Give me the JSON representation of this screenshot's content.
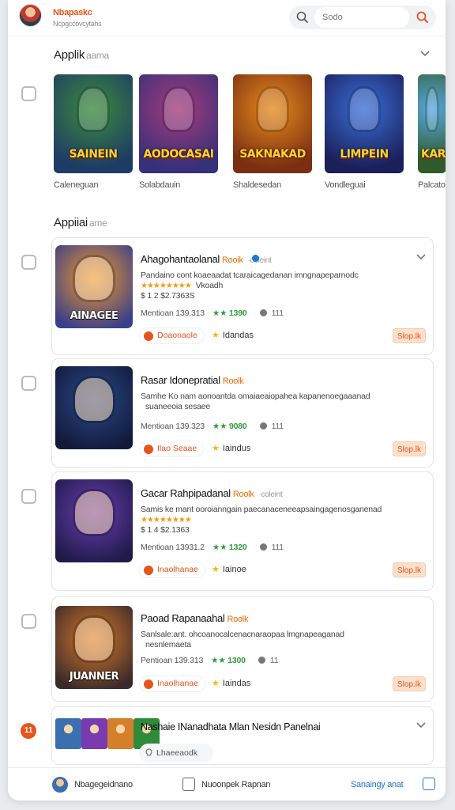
{
  "header": {
    "brand": "Nbapaskc",
    "brand_sub": "Ncpgccovcytahs",
    "search_placeholder": "Sodo"
  },
  "featured": {
    "title": "Applik",
    "title_muted": "aama",
    "items": [
      {
        "title": "SAINEIN",
        "label": "Caleneguan",
        "color1": "#3c8b3a",
        "color2": "#1d3b66"
      },
      {
        "title": "AODOCASAI",
        "label": "Solabdauin",
        "color1": "#a53b7a",
        "color2": "#37307a"
      },
      {
        "title": "SAKNAKAD",
        "label": "Shaldesedan",
        "color1": "#e68a1d",
        "color2": "#7a2f12"
      },
      {
        "title": "LIMPEIN",
        "label": "Vondleguai",
        "color1": "#3a6fd8",
        "color2": "#1b1f5a"
      },
      {
        "title": "KAR",
        "label": "Palcato",
        "color1": "#5aa8e0",
        "color2": "#2f5a2a"
      }
    ]
  },
  "apps_section": {
    "title": "Appiiai",
    "title_muted": "ame"
  },
  "apps": [
    {
      "thumb_title": "AINAGEE",
      "title": "Ahagohantaolanal",
      "tag": "Rooik",
      "mini": "·coleint",
      "desc_line1": "Pandaino cont koaeaadat tcaraicagedanan imngnapeparnodc",
      "stars": "★★★★★★★★",
      "desc_line2_suffix": "Vkoadh",
      "desc_line3": "$ 1 2 $2.7363S",
      "meta_prefix": "Mentioan 139.313",
      "rating": "★★ 1390",
      "downloads": "111",
      "pill": "Doaonaole",
      "fav": "Idandas",
      "install": "Slop.lk",
      "art1": "#f09a2a",
      "art2": "#3a3f8a"
    },
    {
      "thumb_title": "",
      "title": "Rasar Idonepratial",
      "tag": "Roolk",
      "mini": "",
      "desc_line1": "Samhe Ko nam aonoantda omaiaeaiopahea kapanenoegaaanad",
      "stars": "",
      "desc_line2_suffix": "suaneeoia sesaee",
      "desc_line3": "",
      "meta_prefix": "Mentioan 139.323",
      "rating": "★★ 9080",
      "downloads": "111",
      "pill": "Ilao Seaae",
      "fav": "Iaindus",
      "install": "Slop.lk",
      "art1": "#2a4a8a",
      "art2": "#12193a"
    },
    {
      "thumb_title": "",
      "title": "Gacar Rahpipadanal",
      "tag": "Roolk",
      "mini": "·coleint",
      "desc_line1": "Samis ke mant ooroianngain paecanaceneeapsaingagenosganenad",
      "stars": "★★★★★★★★",
      "desc_line2_suffix": "",
      "desc_line3": "$ 1 4 $2.1363",
      "meta_prefix": "Mentioan 13931.2",
      "rating": "★★ 1320",
      "downloads": "111",
      "pill": "Inaolhanae",
      "fav": "Iainoe",
      "install": "Slop.lk",
      "art1": "#6a3fb0",
      "art2": "#1f1a4a"
    },
    {
      "thumb_title": "JUANNER",
      "title": "Paoad Rapanaahal",
      "tag": "Roolk",
      "mini": "",
      "desc_line1": "Sanlsale:ant. ohcoanocalcenacnaraopaa lmgnapeaganad",
      "stars": "",
      "desc_line2_suffix": "nesnlemaeta",
      "desc_line3": "",
      "meta_prefix": "Pentioan 139.313",
      "rating": "★★ 1300",
      "downloads": "11",
      "pill": "Inaolhanae",
      "fav": "Iaindas",
      "install": "Slop.lk",
      "art1": "#d9792a",
      "art2": "#3a2a2a"
    }
  ],
  "bundle": {
    "badge": "11",
    "title": "Nashaie INanadhata Mlan Nesidn Panelnai",
    "pill": "Lhaeeaodk",
    "thumbs": [
      "#3c6fb0",
      "#7a3ab0",
      "#d4802a",
      "#2f8a3a"
    ]
  },
  "footer": {
    "user": "Nbagegeidnano",
    "report": "Nuoonpek Rapnan",
    "link": "Sanaingy anat"
  }
}
